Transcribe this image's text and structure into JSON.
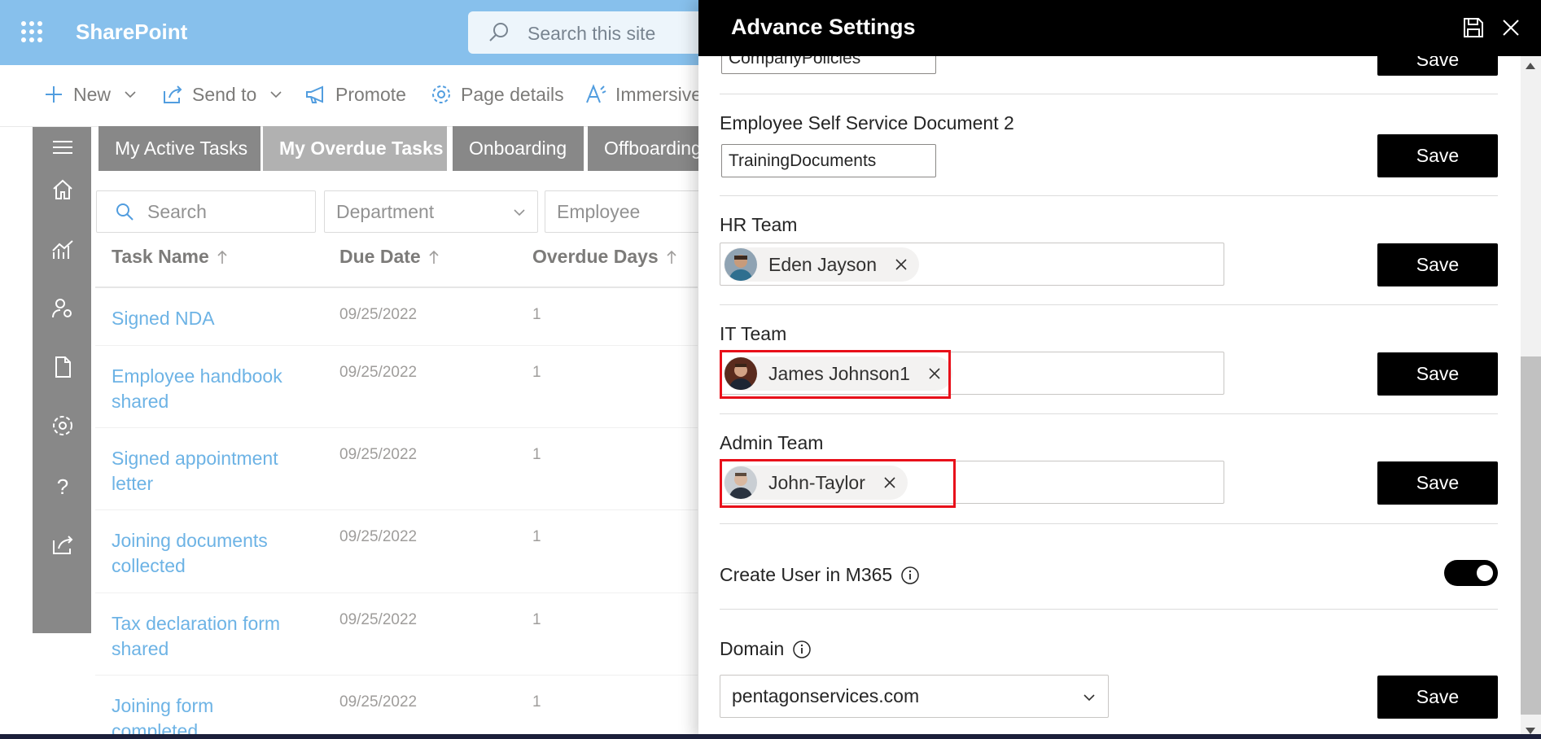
{
  "suitebar": {
    "app_name": "SharePoint",
    "search_placeholder": "Search this site"
  },
  "commandbar": {
    "new": "New",
    "send_to": "Send to",
    "promote": "Promote",
    "page_details": "Page details",
    "immersive": "Immersive"
  },
  "tabs": [
    "My Active Tasks",
    "My Overdue Tasks",
    "Onboarding",
    "Offboarding"
  ],
  "filters": {
    "search_placeholder": "Search",
    "department": "Department",
    "employee": "Employee"
  },
  "table": {
    "columns": [
      "Task Name",
      "Due Date",
      "Overdue Days"
    ],
    "rows": [
      {
        "name": "Signed NDA",
        "due": "09/25/2022",
        "days": "1"
      },
      {
        "name": "Employee handbook shared",
        "due": "09/25/2022",
        "days": "1"
      },
      {
        "name": "Signed appointment letter",
        "due": "09/25/2022",
        "days": "1"
      },
      {
        "name": "Joining documents collected",
        "due": "09/25/2022",
        "days": "1"
      },
      {
        "name": "Tax declaration form shared",
        "due": "09/25/2022",
        "days": "1"
      },
      {
        "name": "Joining form completed",
        "due": "09/25/2022",
        "days": "1"
      }
    ]
  },
  "panel": {
    "title": "Advance Settings",
    "save_label": "Save",
    "doc1_value": "CompanyPolicies",
    "doc2_label": "Employee Self Service Document 2",
    "doc2_value": "TrainingDocuments",
    "hr_label": "HR Team",
    "hr_person": "Eden Jayson",
    "it_label": "IT Team",
    "it_person": "James Johnson1",
    "admin_label": "Admin Team",
    "admin_person": "John-Taylor",
    "create_user_label": "Create User in M365",
    "create_user_enabled": true,
    "domain_label": "Domain",
    "domain_value": "pentagonservices.com"
  },
  "colors": {
    "suitebar": "#6db3e8",
    "link": "#4da3e0",
    "rail": "#6e6e6e",
    "tab_active": "#a0a0a0",
    "tab": "#6e6e6e",
    "highlight": "#e8101a"
  }
}
